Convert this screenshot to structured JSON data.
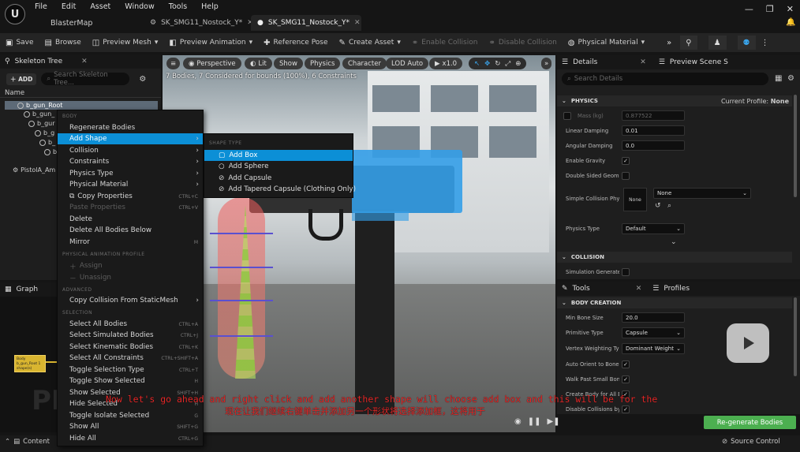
{
  "menu": [
    "File",
    "Edit",
    "Asset",
    "Window",
    "Tools",
    "Help"
  ],
  "project": "BlasterMap",
  "tabs": [
    {
      "label": "SK_SMG11_Nostock_Y*"
    },
    {
      "label": "SK_SMG11_Nostock_Y*"
    }
  ],
  "toolbar": {
    "save": "Save",
    "browse": "Browse",
    "preview_mesh": "Preview Mesh",
    "preview_animation": "Preview Animation",
    "reference_pose": "Reference Pose",
    "create_asset": "Create Asset",
    "enable_collision": "Enable Collision",
    "disable_collision": "Disable Collision",
    "physical_material": "Physical Material"
  },
  "skeleton_tree": {
    "title": "Skeleton Tree",
    "add_label": "ADD",
    "search_placeholder": "Search Skeleton Tree...",
    "name_header": "Name",
    "bones": [
      "b_gun_Root",
      "b_gun_",
      "b_gur",
      "b_g",
      "b_",
      "b",
      "PistolA_Am"
    ]
  },
  "graph": {
    "title": "Graph",
    "node_label": "Body b_gun_Root 1 shape(s)",
    "watermark": "PI"
  },
  "content_browser": "Content",
  "viewport": {
    "perspective": "Perspective",
    "lit": "Lit",
    "show": "Show",
    "physics": "Physics",
    "character": "Character",
    "lod": "LOD Auto",
    "speed": "x1.0",
    "info": "7 Bodies, 7 Considered for bounds (100%), 6 Constraints"
  },
  "context_menu": {
    "sections": {
      "body": "BODY",
      "physical_animation_profile": "PHYSICAL ANIMATION PROFILE",
      "advanced": "ADVANCED",
      "selection": "SELECTION"
    },
    "items": [
      {
        "label": "Regenerate Bodies",
        "shortcut": ""
      },
      {
        "label": "Add Shape",
        "shortcut": ""
      },
      {
        "label": "Collision",
        "shortcut": ""
      },
      {
        "label": "Constraints",
        "shortcut": ""
      },
      {
        "label": "Physics Type",
        "shortcut": ""
      },
      {
        "label": "Physical Material",
        "shortcut": ""
      },
      {
        "label": "Copy Properties",
        "shortcut": "CTRL+C"
      },
      {
        "label": "Paste Properties",
        "shortcut": "CTRL+V"
      },
      {
        "label": "Delete",
        "shortcut": ""
      },
      {
        "label": "Delete All Bodies Below",
        "shortcut": ""
      },
      {
        "label": "Mirror",
        "shortcut": "M"
      },
      {
        "label": "Assign",
        "shortcut": ""
      },
      {
        "label": "Unassign",
        "shortcut": ""
      },
      {
        "label": "Copy Collision From StaticMesh",
        "shortcut": ""
      },
      {
        "label": "Select All Bodies",
        "shortcut": "CTRL+A"
      },
      {
        "label": "Select Simulated Bodies",
        "shortcut": "CTRL+J"
      },
      {
        "label": "Select Kinematic Bodies",
        "shortcut": "CTRL+K"
      },
      {
        "label": "Select All Constraints",
        "shortcut": "CTRL+SHIFT+A"
      },
      {
        "label": "Toggle Selection Type",
        "shortcut": "CTRL+T"
      },
      {
        "label": "Toggle Show Selected",
        "shortcut": "H"
      },
      {
        "label": "Show Selected",
        "shortcut": "SHIFT+H"
      },
      {
        "label": "Hide Selected",
        "shortcut": "H"
      },
      {
        "label": "Toggle Isolate Selected",
        "shortcut": "G"
      },
      {
        "label": "Show All",
        "shortcut": "SHIFT+G"
      },
      {
        "label": "Hide All",
        "shortcut": "CTRL+G"
      }
    ]
  },
  "submenu": {
    "section": "SHAPE TYPE",
    "items": [
      "Add Box",
      "Add Sphere",
      "Add Capsule",
      "Add Tapered Capsule (Clothing Only)"
    ]
  },
  "details": {
    "title": "Details",
    "preview_tab": "Preview Scene S",
    "search_placeholder": "Search Details",
    "physics_section": "PHYSICS",
    "current_profile_label": "Current Profile:",
    "current_profile_value": "None",
    "mass_label": "Mass (kg)",
    "mass_value": "0.877522",
    "linear_damping_label": "Linear Damping",
    "linear_damping_value": "0.01",
    "angular_damping_label": "Angular Damping",
    "angular_damping_value": "0.0",
    "enable_gravity_label": "Enable Gravity",
    "double_sided_label": "Double Sided Geome",
    "simple_collision_label": "Simple Collision Phys",
    "simple_collision_thumb": "None",
    "simple_collision_value": "None",
    "physics_type_label": "Physics Type",
    "physics_type_value": "Default",
    "collision_section": "COLLISION",
    "sim_generates_label": "Simulation Generate"
  },
  "tools": {
    "title": "Tools",
    "profiles_tab": "Profiles",
    "section": "BODY CREATION",
    "min_bone_size_label": "Min Bone Size",
    "min_bone_size_value": "20.0",
    "primitive_type_label": "Primitive Type",
    "primitive_type_value": "Capsule",
    "vertex_weighting_label": "Vertex Weighting Typ",
    "vertex_weighting_value": "Dominant Weight",
    "auto_orient_label": "Auto Orient to Bone",
    "walk_past_label": "Walk Past Small Bon",
    "create_body_label": "Create Body for All B",
    "disable_collisions_label": "Disable Collisions by",
    "regenerate_button": "Re-generate Bodies"
  },
  "status": {
    "source_control": "Source Control"
  },
  "subtitles": {
    "en": "Now let's go ahead and right click and add another shape will choose add box and this will be for the",
    "zh": "现在让我们继续右键单击并添加另一个形状将选择添加框，这将用于"
  },
  "colors": {
    "highlight": "#0c8fd6",
    "regen": "#4caf50",
    "subtitle": "#e42828",
    "body_blue": "#349ee8"
  }
}
